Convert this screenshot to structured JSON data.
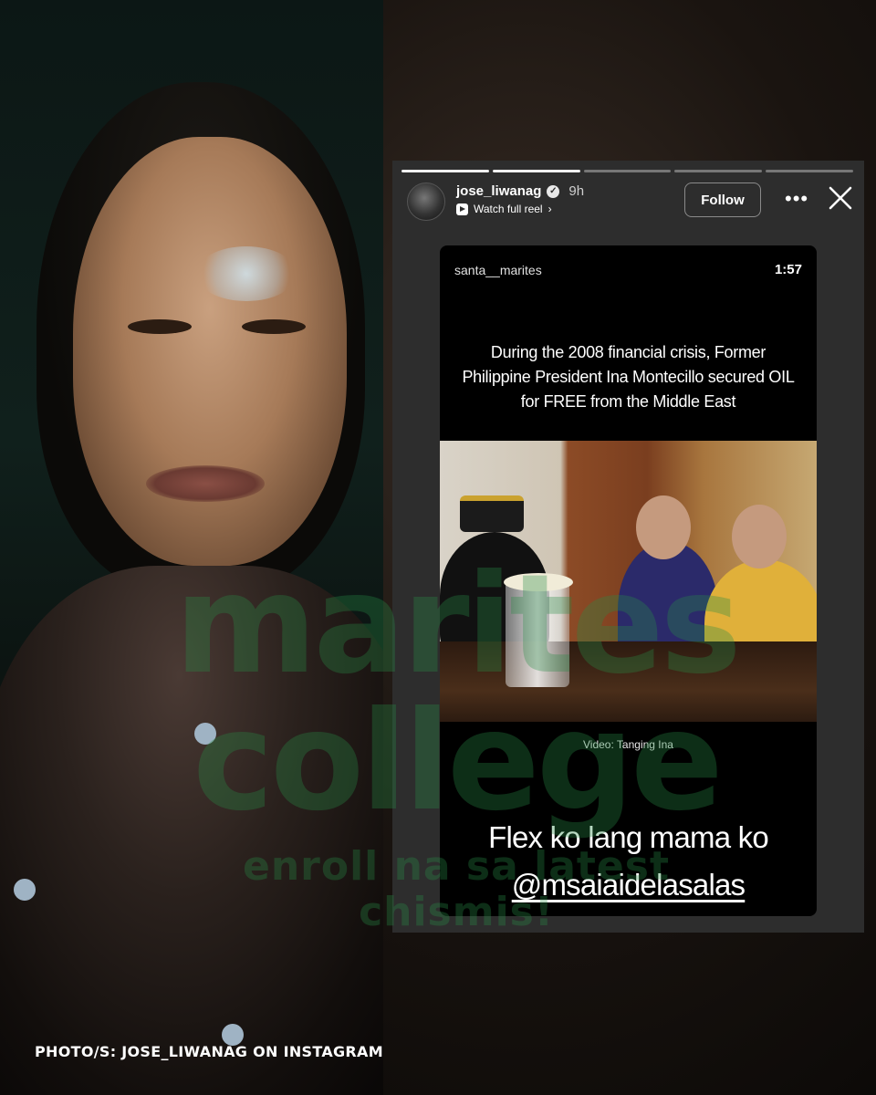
{
  "story": {
    "username": "jose_liwanag",
    "time_ago": "9h",
    "watch_full_reel": "Watch full reel",
    "follow_label": "Follow",
    "more_label": "•••"
  },
  "reel": {
    "username": "santa__marites",
    "duration": "1:57",
    "caption": "During the 2008 financial crisis, Former Philippine President Ina Montecillo secured OIL for FREE from the Middle East",
    "video_credit": "Video: Tanging Ina",
    "sticker_text": "Flex ko lang mama ko",
    "sticker_mention": "@msaiaidelasalas"
  },
  "watermark": {
    "line1": "marites",
    "line2": "college",
    "line3": "enroll na sa latest chismis!"
  },
  "photo_credit": "PHOTO/S: JOSE_LIWANAG ON INSTAGRAM",
  "colors": {
    "story_bg": "#2d2d2d",
    "card_bg": "#000000",
    "watermark": "#288c46"
  },
  "icons": [
    "verified-icon",
    "play-icon",
    "chevron-right-icon",
    "more-icon",
    "close-icon"
  ]
}
